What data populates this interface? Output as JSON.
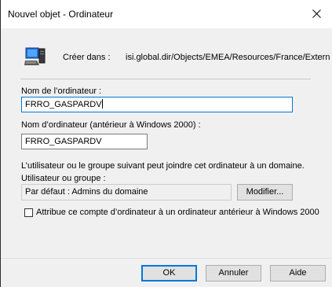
{
  "window": {
    "title": "Nouvel objet - Ordinateur",
    "close_glyph": "close-icon"
  },
  "create_in": {
    "label": "Créer dans :",
    "path": "isi.global.dir/Objects/EMEA/Resources/France/Extern",
    "icon": "computer-icon"
  },
  "computer_name": {
    "label": "Nom de l’ordinateur :",
    "value": "FRRO_GASPARDV"
  },
  "computer_name_pre2000": {
    "label": "Nom d’ordinateur (antérieur à Windows 2000) :",
    "value": "FRRO_GASPARDV"
  },
  "join_info": {
    "text": "L’utilisateur ou le groupe suivant peut joindre cet ordinateur à un domaine.",
    "label": "Utilisateur ou groupe :",
    "value": "Par défaut : Admins du domaine",
    "modify_label": "Modifier..."
  },
  "legacy_checkbox": {
    "label": "Attribue ce compte d’ordinateur à un ordinateur antérieur à Windows 2000",
    "checked": false
  },
  "buttons": {
    "ok": "OK",
    "cancel": "Annuler",
    "help": "Aide"
  }
}
